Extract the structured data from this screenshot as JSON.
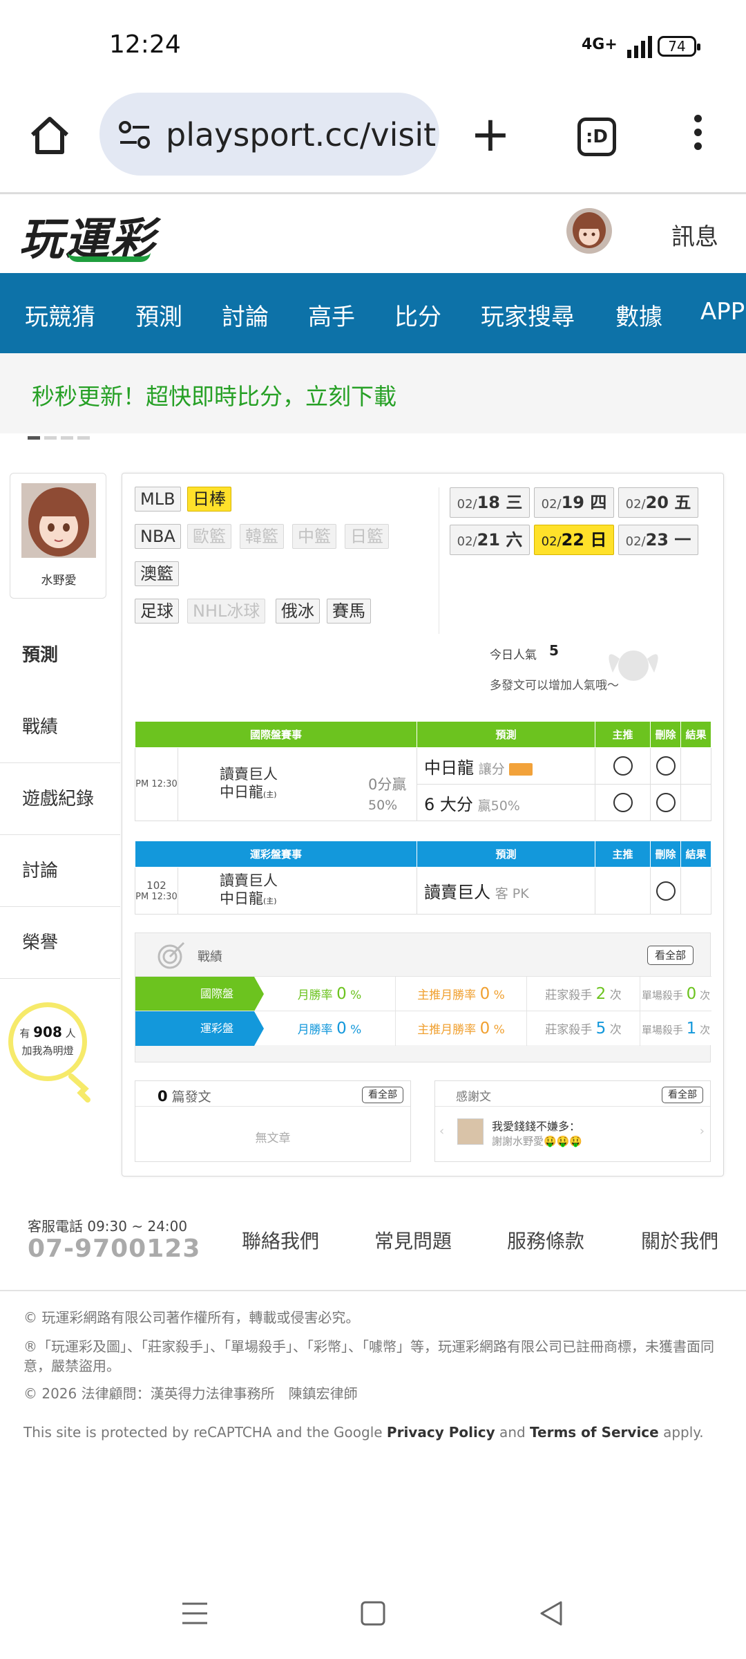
{
  "status_bar": {
    "time": "12:24",
    "network": "4G+",
    "battery": "74"
  },
  "browser": {
    "url": "playsport.cc/visit",
    "tab_label": ":D"
  },
  "site": {
    "logo": "玩運彩",
    "messages_label": "訊息"
  },
  "nav": [
    "玩競猜",
    "預測",
    "討論",
    "高手",
    "比分",
    "玩家搜尋",
    "數據",
    "APP"
  ],
  "banner": {
    "text": "秒秒更新！超快即時比分，立刻下載"
  },
  "profile": {
    "name": "水野愛"
  },
  "side_menu": [
    "預測",
    "戰績",
    "遊戲紀錄",
    "討論",
    "榮譽"
  ],
  "lightbulb": {
    "prefix": "有",
    "count": "908",
    "suffix": "人",
    "line2": "加我為明燈"
  },
  "sport_tags": {
    "row1": [
      "MLB",
      "日棒"
    ],
    "row2": [
      "NBA",
      "歐籃",
      "韓籃",
      "中籃",
      "日籃"
    ],
    "row3": [
      "澳籃"
    ],
    "row4": [
      "足球",
      "NHL冰球",
      "俄冰",
      "賽馬"
    ]
  },
  "dates": [
    {
      "md": "02/",
      "day": "18 三"
    },
    {
      "md": "02/",
      "day": "19 四"
    },
    {
      "md": "02/",
      "day": "20 五"
    },
    {
      "md": "02/",
      "day": "21 六"
    },
    {
      "md": "02/",
      "day": "22 日"
    },
    {
      "md": "02/",
      "day": "23 一"
    }
  ],
  "popularity": {
    "label": "今日人氣",
    "value": "5",
    "hint": "多發文可以增加人氣哦～"
  },
  "intl_table": {
    "headers": [
      "國際盤賽事",
      "預測",
      "主推",
      "刪除",
      "結果"
    ],
    "time": "PM 12:30",
    "away": "讀賣巨人",
    "home": "中日龍",
    "home_tag": "(主)",
    "odds1": "0分贏",
    "odds2": "50%",
    "pick1_team": "中日龍",
    "pick1_type": "讓分",
    "pick2_main": "6 大分",
    "pick2_sub": "贏50%"
  },
  "lottery_table": {
    "headers": [
      "運彩盤賽事",
      "預測",
      "主推",
      "刪除",
      "結果"
    ],
    "num": "102",
    "time": "PM 12:30",
    "away": "讀賣巨人",
    "home": "中日龍",
    "home_tag": "(主)",
    "pick_team": "讀賣巨人",
    "pick_type": "客 PK"
  },
  "record": {
    "title": "戰績",
    "view_all": "看全部",
    "rows": [
      {
        "label": "國際盤",
        "monthly": "月勝率",
        "monthly_v": "0",
        "main": "主推月勝率",
        "main_v": "0",
        "killer": "莊家殺手",
        "killer_v": "2",
        "single": "單場殺手",
        "single_v": "0",
        "unit_pct": "%",
        "unit_times": "次"
      },
      {
        "label": "運彩盤",
        "monthly": "月勝率",
        "monthly_v": "0",
        "main": "主推月勝率",
        "main_v": "0",
        "killer": "莊家殺手",
        "killer_v": "5",
        "single": "單場殺手",
        "single_v": "1",
        "unit_pct": "%",
        "unit_times": "次"
      }
    ]
  },
  "posts": {
    "count": "0",
    "label": "篇發文",
    "view_all": "看全部",
    "empty": "無文章"
  },
  "thanks": {
    "title": "感謝文",
    "view_all": "看全部",
    "line1": "我愛錢錢不嫌多：",
    "line2": "謝謝水野愛🤑🤑🤑"
  },
  "footer": {
    "phone_label": "客服電話 09:30 ~ 24:00",
    "phone": "07-9700123",
    "links": [
      "聯絡我們",
      "常見問題",
      "服務條款",
      "關於我們"
    ],
    "copyright": "© 玩運彩網路有限公司著作權所有，轉載或侵害必究。",
    "trademark": "®「玩運彩及圖」、「莊家殺手」、「單場殺手」、「彩幣」、「噱幣」等，玩運彩網路有限公司已註冊商標，未獲書面同意，嚴禁盜用。",
    "legal": "© 2026 法律顧問：漢英得力法律事務所　陳鎮宏律師",
    "recaptcha_pre": "This site is protected by reCAPTCHA and the Google ",
    "privacy": "Privacy Policy",
    "and": " and ",
    "terms": "Terms of Service",
    "apply": " apply."
  },
  "colors": {
    "nav_blue": "#0d72a8",
    "green": "#6cc31f",
    "blue": "#1398db",
    "highlight_yellow": "#ffe12a",
    "banner_green": "#26a025"
  }
}
